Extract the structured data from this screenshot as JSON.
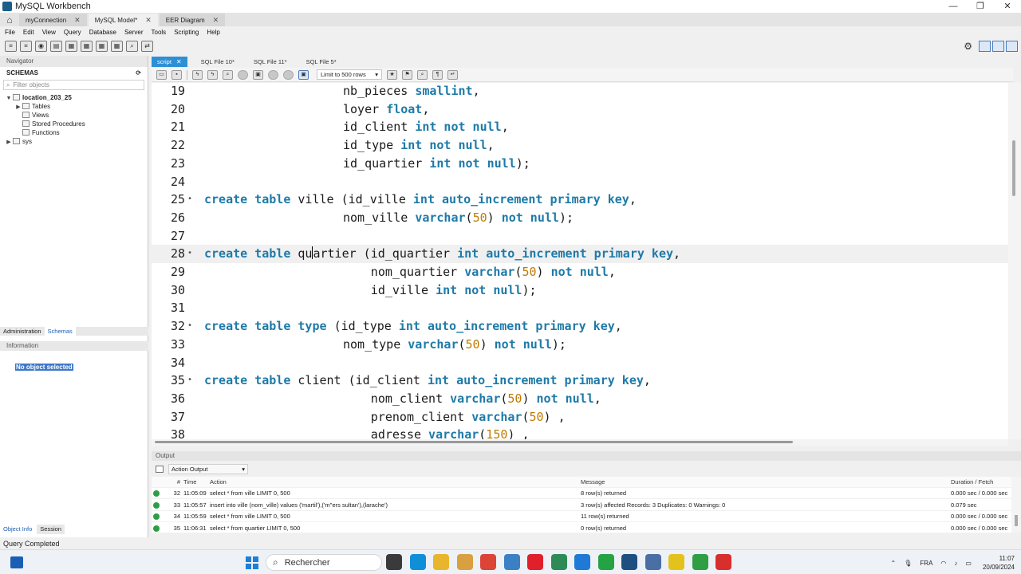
{
  "window": {
    "title": "MySQL Workbench",
    "controls": [
      "—",
      "❐",
      "✕"
    ]
  },
  "connection_tabs": [
    {
      "label": "myConnection",
      "closable": true,
      "active": false
    },
    {
      "label": "MySQL Model*",
      "closable": true,
      "active": false
    },
    {
      "label": "EER Diagram",
      "closable": true,
      "active": false
    }
  ],
  "menu": [
    "File",
    "Edit",
    "View",
    "Query",
    "Database",
    "Server",
    "Tools",
    "Scripting",
    "Help"
  ],
  "navigator": {
    "header": "Navigator",
    "schemas_label": "SCHEMAS",
    "filter_placeholder": "Filter objects",
    "tree": [
      {
        "label": "location_203_25",
        "level": 0,
        "expanded": true,
        "bold": true
      },
      {
        "label": "Tables",
        "level": 1,
        "expanded": false
      },
      {
        "label": "Views",
        "level": 1,
        "expanded": null
      },
      {
        "label": "Stored Procedures",
        "level": 1,
        "expanded": null
      },
      {
        "label": "Functions",
        "level": 1,
        "expanded": null
      },
      {
        "label": "sys",
        "level": 0,
        "expanded": false
      }
    ],
    "tabs": [
      {
        "label": "Administration",
        "active": false
      },
      {
        "label": "Schemas",
        "active": true
      }
    ],
    "information_header": "Information",
    "no_object": "No object selected",
    "bottom_tabs": [
      {
        "label": "Object Info",
        "active": true
      },
      {
        "label": "Session",
        "active": false
      }
    ]
  },
  "script_tabs": [
    {
      "label": "script",
      "active": true
    },
    {
      "label": "SQL File 10*",
      "active": false
    },
    {
      "label": "SQL File 11*",
      "active": false
    },
    {
      "label": "SQL File 5*",
      "active": false
    }
  ],
  "editor_toolbar": {
    "limit_label": "Limit to 500 rows"
  },
  "editor": {
    "lines": [
      {
        "n": "19",
        "fold": false,
        "indent": 20,
        "tokens": [
          [
            "t",
            "nb_pieces "
          ],
          [
            "k",
            "smallint"
          ],
          [
            "t",
            ","
          ]
        ]
      },
      {
        "n": "20",
        "fold": false,
        "indent": 20,
        "tokens": [
          [
            "t",
            "loyer "
          ],
          [
            "k",
            "float"
          ],
          [
            "t",
            ","
          ]
        ]
      },
      {
        "n": "21",
        "fold": false,
        "indent": 20,
        "tokens": [
          [
            "t",
            "id_client "
          ],
          [
            "k",
            "int not null"
          ],
          [
            "t",
            ","
          ]
        ]
      },
      {
        "n": "22",
        "fold": false,
        "indent": 20,
        "tokens": [
          [
            "t",
            "id_type "
          ],
          [
            "k",
            "int not null"
          ],
          [
            "t",
            ","
          ]
        ]
      },
      {
        "n": "23",
        "fold": false,
        "indent": 20,
        "tokens": [
          [
            "t",
            "id_quartier "
          ],
          [
            "k",
            "int not null"
          ],
          [
            "t",
            ");"
          ]
        ]
      },
      {
        "n": "24",
        "fold": false,
        "indent": 0,
        "tokens": []
      },
      {
        "n": "25",
        "fold": true,
        "indent": 0,
        "tokens": [
          [
            "k",
            "create table "
          ],
          [
            "t",
            "ville (id_ville "
          ],
          [
            "k",
            "int auto_increment primary key"
          ],
          [
            "t",
            ","
          ]
        ]
      },
      {
        "n": "26",
        "fold": false,
        "indent": 20,
        "tokens": [
          [
            "t",
            "nom_ville "
          ],
          [
            "k",
            "varchar"
          ],
          [
            "t",
            "("
          ],
          [
            "n",
            "50"
          ],
          [
            "t",
            ") "
          ],
          [
            "k",
            "not null"
          ],
          [
            "t",
            ");"
          ]
        ]
      },
      {
        "n": "27",
        "fold": false,
        "indent": 0,
        "tokens": []
      },
      {
        "n": "28",
        "fold": true,
        "indent": 0,
        "current": true,
        "tokens": [
          [
            "k",
            "create table "
          ],
          [
            "t",
            "qu"
          ],
          [
            "c",
            ""
          ],
          [
            "t",
            "artier (id_quartier "
          ],
          [
            "k",
            "int auto_increment primary key"
          ],
          [
            "t",
            ","
          ]
        ]
      },
      {
        "n": "29",
        "fold": false,
        "indent": 24,
        "tokens": [
          [
            "t",
            "nom_quartier "
          ],
          [
            "k",
            "varchar"
          ],
          [
            "t",
            "("
          ],
          [
            "n",
            "50"
          ],
          [
            "t",
            ") "
          ],
          [
            "k",
            "not null"
          ],
          [
            "t",
            ","
          ]
        ]
      },
      {
        "n": "30",
        "fold": false,
        "indent": 24,
        "tokens": [
          [
            "t",
            "id_ville "
          ],
          [
            "k",
            "int not null"
          ],
          [
            "t",
            ");"
          ]
        ]
      },
      {
        "n": "31",
        "fold": false,
        "indent": 0,
        "tokens": []
      },
      {
        "n": "32",
        "fold": true,
        "indent": 0,
        "tokens": [
          [
            "k",
            "create table type "
          ],
          [
            "t",
            "(id_type "
          ],
          [
            "k",
            "int auto_increment primary key"
          ],
          [
            "t",
            ","
          ]
        ]
      },
      {
        "n": "33",
        "fold": false,
        "indent": 20,
        "tokens": [
          [
            "t",
            "nom_type "
          ],
          [
            "k",
            "varchar"
          ],
          [
            "t",
            "("
          ],
          [
            "n",
            "50"
          ],
          [
            "t",
            ") "
          ],
          [
            "k",
            "not null"
          ],
          [
            "t",
            ");"
          ]
        ]
      },
      {
        "n": "34",
        "fold": false,
        "indent": 0,
        "tokens": []
      },
      {
        "n": "35",
        "fold": true,
        "indent": 0,
        "tokens": [
          [
            "k",
            "create table "
          ],
          [
            "t",
            "client (id_client "
          ],
          [
            "k",
            "int auto_increment primary key"
          ],
          [
            "t",
            ","
          ]
        ]
      },
      {
        "n": "36",
        "fold": false,
        "indent": 24,
        "tokens": [
          [
            "t",
            "nom_client "
          ],
          [
            "k",
            "varchar"
          ],
          [
            "t",
            "("
          ],
          [
            "n",
            "50"
          ],
          [
            "t",
            ") "
          ],
          [
            "k",
            "not null"
          ],
          [
            "t",
            ","
          ]
        ]
      },
      {
        "n": "37",
        "fold": false,
        "indent": 24,
        "tokens": [
          [
            "t",
            "prenom_client "
          ],
          [
            "k",
            "varchar"
          ],
          [
            "t",
            "("
          ],
          [
            "n",
            "50"
          ],
          [
            "t",
            ") ,"
          ]
        ]
      },
      {
        "n": "38",
        "fold": false,
        "indent": 24,
        "tokens": [
          [
            "t",
            "adresse "
          ],
          [
            "k",
            "varchar"
          ],
          [
            "t",
            "("
          ],
          [
            "n",
            "150"
          ],
          [
            "t",
            ") ,"
          ]
        ]
      }
    ]
  },
  "output": {
    "header": "Output",
    "selector": "Action Output",
    "columns": {
      "num": "#",
      "time": "Time",
      "action": "Action",
      "message": "Message",
      "duration": "Duration / Fetch"
    },
    "rows": [
      {
        "num": "32",
        "time": "11:05:09",
        "action": "select * from ville LIMIT 0, 500",
        "message": "8 row(s) returned",
        "duration": "0.000 sec / 0.000 sec"
      },
      {
        "num": "33",
        "time": "11:05:57",
        "action": "insert into ville (nom_ville) values ('martil'),('m''ers sultan'),(larache')",
        "message": "3 row(s) affected Records: 3  Duplicates: 0  Warnings: 0",
        "duration": "0.079 sec"
      },
      {
        "num": "34",
        "time": "11:05:59",
        "action": "select * from ville LIMIT 0, 500",
        "message": "11 row(s) returned",
        "duration": "0.000 sec / 0.000 sec"
      },
      {
        "num": "35",
        "time": "11:06:31",
        "action": "select * from quartier LIMIT 0, 500",
        "message": "0 row(s) returned",
        "duration": "0.000 sec / 0.000 sec"
      }
    ]
  },
  "status": "Query Completed",
  "taskbar": {
    "search_placeholder": "Rechercher",
    "apps": [
      {
        "name": "file-explorer",
        "color": "#3a3a3a"
      },
      {
        "name": "edge",
        "color": "#0f8fd8"
      },
      {
        "name": "explorer-folder",
        "color": "#e8b52c"
      },
      {
        "name": "paint",
        "color": "#d8a040"
      },
      {
        "name": "chrome",
        "color": "#db4437"
      },
      {
        "name": "network",
        "color": "#3b7fc4"
      },
      {
        "name": "opera",
        "color": "#e0202a"
      },
      {
        "name": "vpn",
        "color": "#2e8b57"
      },
      {
        "name": "vscode",
        "color": "#1e7ad6"
      },
      {
        "name": "whatsapp",
        "color": "#25a244"
      },
      {
        "name": "mysql-workbench",
        "color": "#1f4f80"
      },
      {
        "name": "network-tool",
        "color": "#4a6fa5"
      },
      {
        "name": "sticky-notes",
        "color": "#e4c21c"
      },
      {
        "name": "camtasia",
        "color": "#2f9e44"
      },
      {
        "name": "recorder",
        "color": "#d92e2e"
      }
    ],
    "tray": {
      "language": "FRA",
      "time": "11:07",
      "date": "20/09/2024"
    }
  }
}
